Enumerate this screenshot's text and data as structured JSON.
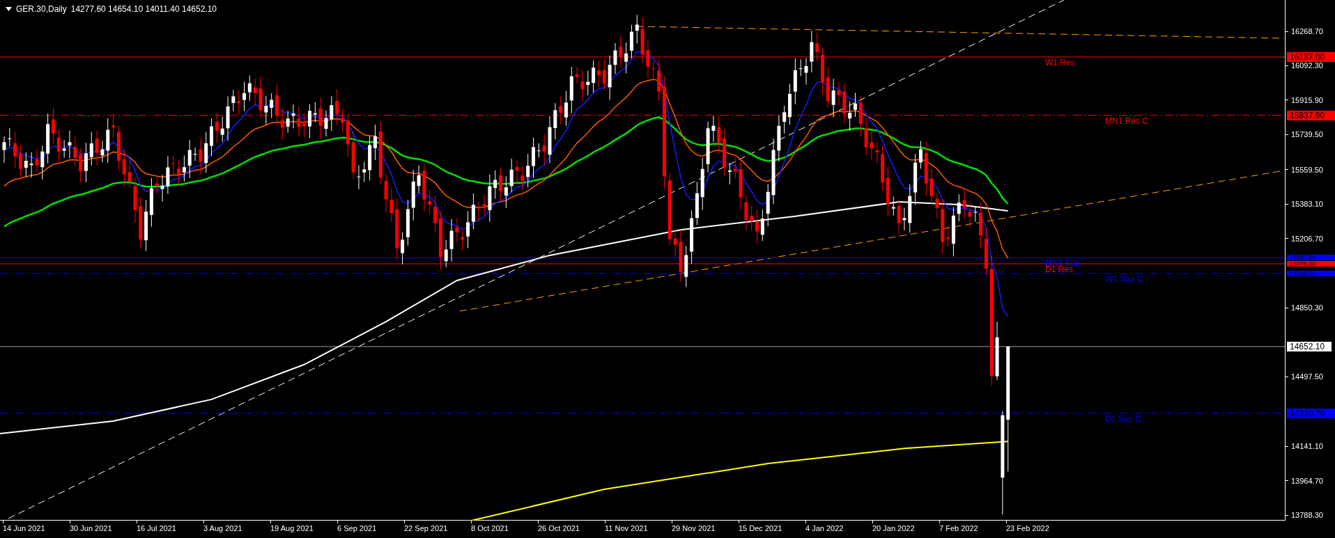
{
  "chart_title": {
    "symbol": "GER.30,Daily",
    "ohlc": "14277.60 14654.10 14011.40 14652.10"
  },
  "y_axis": [
    "16268.70",
    "16092.30",
    "15915.90",
    "15739.50",
    "15559.50",
    "15383.10",
    "15206.70",
    "14850.30",
    "14497.50",
    "14141.10",
    "13964.70",
    "13788.30"
  ],
  "levels": [
    {
      "label": "W1 Res",
      "price": "16137.00",
      "color": "#ff0000",
      "kind": "solid"
    },
    {
      "label": "MN1 Res C",
      "price": "15837.90",
      "color": "#ff0000",
      "kind": "dashdot"
    },
    {
      "label": "MN1 Sup",
      "price": "15107.10",
      "color": "#0000ff",
      "kind": "solid"
    },
    {
      "label": "D1 Res",
      "price": "15076.80",
      "color": "#ff0000",
      "kind": "solid"
    },
    {
      "label": "W1 Sup C",
      "price": "15026.80",
      "color": "#0000ff",
      "kind": "dashdot"
    },
    {
      "label": "D1 Sup C",
      "price": "14310.70",
      "color": "#0000ff",
      "kind": "dashdot"
    }
  ],
  "current_price": "14652.10",
  "x_axis": [
    "14 Jun 2021",
    "30 Jun 2021",
    "16 Jul 2021",
    "3 Aug 2021",
    "19 Aug 2021",
    "6 Sep 2021",
    "22 Sep 2021",
    "8 Oct 2021",
    "26 Oct 2021",
    "11 Nov 2021",
    "29 Nov 2021",
    "15 Dec 2021",
    "4 Jan 2022",
    "20 Jan 2022",
    "7 Feb 2022",
    "23 Feb 2022"
  ]
}
